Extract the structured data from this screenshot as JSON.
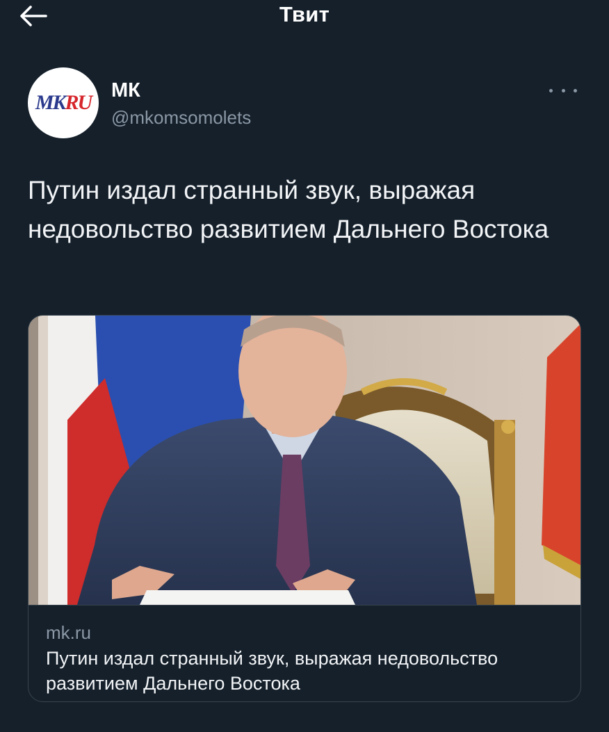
{
  "header": {
    "title": "Твит",
    "back_icon": "arrow-left-icon"
  },
  "author": {
    "name": "МК",
    "handle": "@mkomsomolets",
    "avatar_logo": {
      "part1": "MK",
      "part2": "RU"
    },
    "more_icon": "more-horizontal-icon"
  },
  "tweet": {
    "text": "Путин издал странный звук, выражая недовольство развитием Дальнего Востока"
  },
  "card": {
    "domain": "mk.ru",
    "title": "Путин издал странный звук, выражая недовольство развитием Дальнего Востока"
  },
  "colors": {
    "background": "#15202b",
    "secondary_text": "#8b98a5",
    "border": "#38444d"
  }
}
